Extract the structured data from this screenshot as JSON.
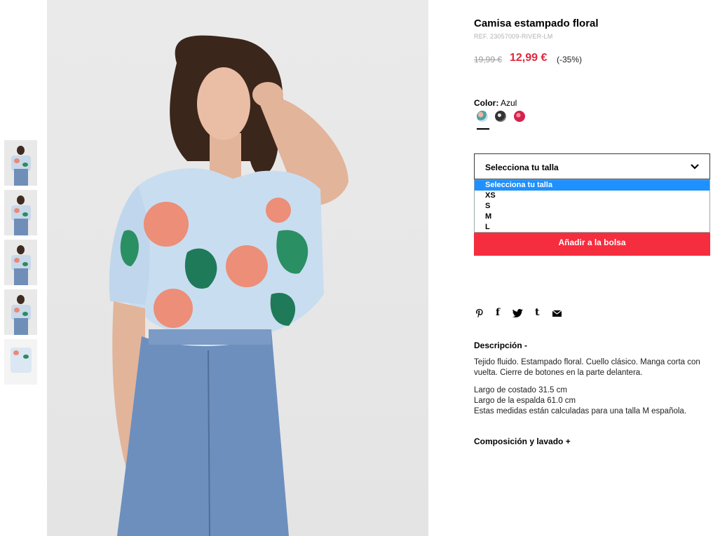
{
  "product": {
    "title": "Camisa estampado floral",
    "ref": "REF. 23057009-RIVER-LM",
    "old_price": "19,99 €",
    "new_price": "12,99 €",
    "discount": "(-35%)"
  },
  "color": {
    "label": "Color:",
    "value": "Azul",
    "swatches": [
      "swatch-floral-blue",
      "swatch-black",
      "swatch-pink"
    ]
  },
  "size": {
    "placeholder": "Selecciona tu talla",
    "options": [
      "Selecciona tu talla",
      "XS",
      "S",
      "M",
      "L"
    ]
  },
  "cta": {
    "add_to_bag": "Añadir a la bolsa"
  },
  "social_icons": [
    "pinterest-icon",
    "facebook-icon",
    "twitter-icon",
    "tumblr-icon",
    "mail-icon"
  ],
  "description": {
    "heading": "Descripción -",
    "p1": "Tejido fluido. Estampado floral. Cuello clásico. Manga corta con vuelta. Cierre de botones en la parte delantera.",
    "line1": "Largo de costado 31.5 cm",
    "line2": "Largo de la espalda 61.0 cm",
    "line3": "Estas medidas están calculadas para una talla M española."
  },
  "composition": {
    "heading": "Composición y lavado +"
  },
  "colors": {
    "accent": "#f52d3e",
    "price": "#e02840",
    "select_highlight": "#1e90ff"
  }
}
